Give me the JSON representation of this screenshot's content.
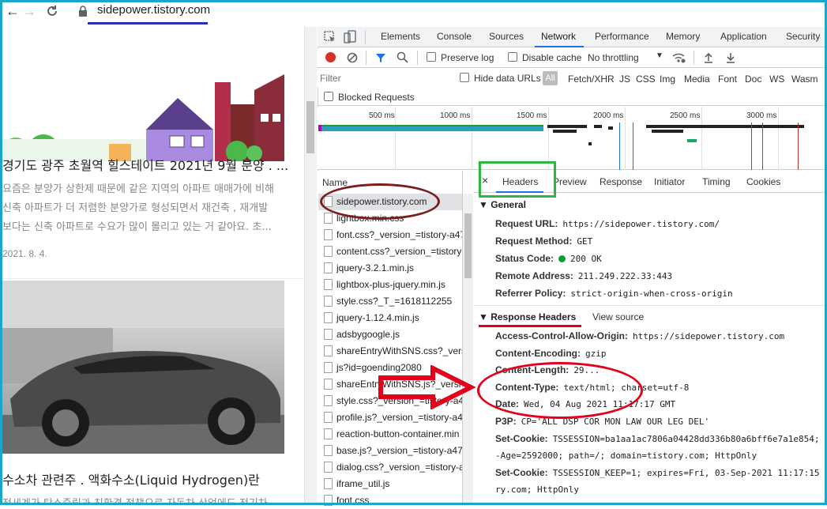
{
  "browser": {
    "url": "sidepower.tistory.com"
  },
  "webpage": {
    "posts": [
      {
        "title": "경기도 광주 초월역 힐스테이트 2021년 9월 분양 . ...",
        "excerpt": [
          "요즘은 분양가 상한제 때문에 같은 지역의 아파트 매매가에 비해",
          "신축 아파트가 더 저렴한 분양가로 형성되면서 재건축 , 재개발",
          "보다는 신축 아파트로 수요가 많이 몰리고 있는 거 같아요. 초..."
        ],
        "date": "2021. 8. 4."
      },
      {
        "title": "수소차 관련주 . 액화수소(Liquid Hydrogen)란",
        "excerpt": [
          "전세계가 탄소중립과 친환경 정책으로 자동차 산업에도 전기차"
        ]
      }
    ]
  },
  "devtools": {
    "tabs": [
      "Elements",
      "Console",
      "Sources",
      "Network",
      "Performance",
      "Memory",
      "Application",
      "Security"
    ],
    "active_tab": "Network",
    "toolbar": {
      "preserve_log": "Preserve log",
      "disable_cache": "Disable cache",
      "throttling": "No throttling"
    },
    "filter": {
      "placeholder": "Filter",
      "hide_data_urls": "Hide data URLs",
      "all": "All",
      "types": [
        "Fetch/XHR",
        "JS",
        "CSS",
        "Img",
        "Media",
        "Font",
        "Doc",
        "WS",
        "Wasm"
      ]
    },
    "blocked_requests": "Blocked Requests",
    "timeline_labels": [
      "500 ms",
      "1000 ms",
      "1500 ms",
      "2000 ms",
      "2500 ms",
      "3000 ms"
    ],
    "name_header": "Name",
    "requests": [
      "sidepower.tistory.com",
      "lightbox.min.css",
      "font.css?_version_=tistory-a47",
      "content.css?_version_=tistory-",
      "jquery-3.2.1.min.js",
      "lightbox-plus-jquery.min.js",
      "style.css?_T_=1618112255",
      "jquery-1.12.4.min.js",
      "adsbygoogle.js",
      "shareEntryWithSNS.css?_versi",
      "js?id=goending2080",
      "shareEntryWithSNS.js?_versi",
      "style.css?_version_=tistory-a4",
      "profile.js?_version_=tistory-a4",
      "reaction-button-container.min",
      "base.js?_version_=tistory-a476",
      "dialog.css?_version_=tistory-a",
      "iframe_util.js",
      "font.css"
    ],
    "detail_tabs": [
      "Headers",
      "Preview",
      "Response",
      "Initiator",
      "Timing",
      "Cookies"
    ],
    "general": {
      "title": "General",
      "rows": [
        {
          "k": "Request URL:",
          "v": "https://sidepower.tistory.com/"
        },
        {
          "k": "Request Method:",
          "v": "GET"
        },
        {
          "k": "Status Code:",
          "v": "200 OK"
        },
        {
          "k": "Remote Address:",
          "v": "211.249.222.33:443"
        },
        {
          "k": "Referrer Policy:",
          "v": "strict-origin-when-cross-origin"
        }
      ]
    },
    "response_headers": {
      "title": "Response Headers",
      "view_source": "View source",
      "rows": [
        {
          "k": "Access-Control-Allow-Origin:",
          "v": "https://sidepower.tistory.com"
        },
        {
          "k": "Content-Encoding:",
          "v": "gzip"
        },
        {
          "k": "Content-Length:",
          "v": "29..."
        },
        {
          "k": "Content-Type:",
          "v": "text/html; charset=utf-8"
        },
        {
          "k": "Date:",
          "v": "Wed, 04 Aug 2021 11:17:17 GMT"
        },
        {
          "k": "P3P:",
          "v": "CP='ALL DSP COR MON LAW OUR LEG DEL'"
        },
        {
          "k": "Set-Cookie:",
          "v": "TSSESSION=ba1aa1ac7806a04428dd336b80a6bff6e7a1e854; e"
        },
        {
          "k": "",
          "v": "-Age=2592000; path=/; domain=tistory.com; HttpOnly"
        },
        {
          "k": "Set-Cookie:",
          "v": "TSSESSION_KEEP=1; expires=Fri, 03-Sep-2021 11:17:15 G"
        },
        {
          "k": "",
          "v": "ry.com; HttpOnly"
        }
      ]
    }
  }
}
